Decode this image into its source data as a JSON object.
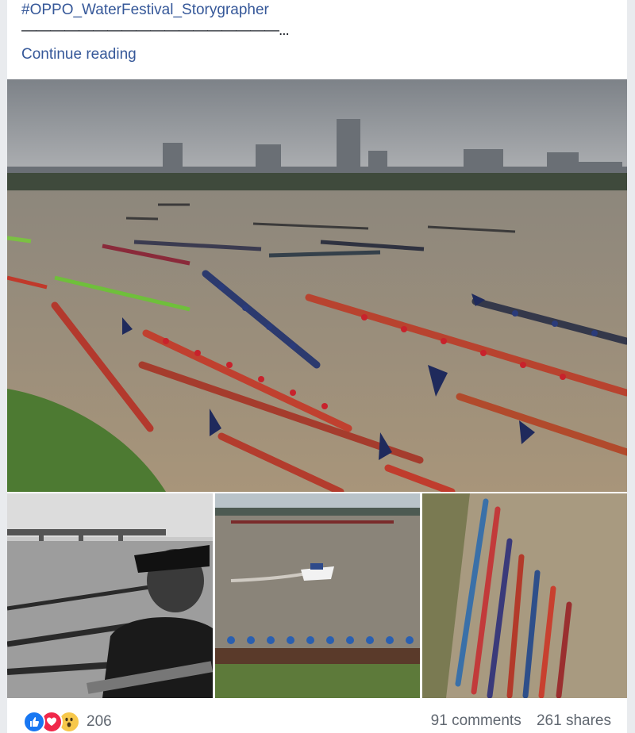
{
  "post": {
    "hashtag": "#OPPO_WaterFestival_Storygrapher",
    "dashes": "——————————————————...",
    "continue_label": "Continue reading"
  },
  "photos": [
    {
      "name": "main-photo-boat-race",
      "subject": "dragon boats on river with city skyline"
    },
    {
      "name": "photo-man-bridge-bw",
      "subject": "black and white man watching boats near bridge"
    },
    {
      "name": "photo-speedboat-rowers",
      "subject": "speedboat and rowing team on river"
    },
    {
      "name": "photo-aerial-boats",
      "subject": "aerial view of long boats lined at shore"
    }
  ],
  "footer": {
    "reaction_count": "206",
    "comments": "91 comments",
    "shares": "261 shares"
  },
  "colors": {
    "link": "#365899",
    "like": "#1877f2",
    "love": "#f0284a",
    "wow": "#f7c84b"
  }
}
